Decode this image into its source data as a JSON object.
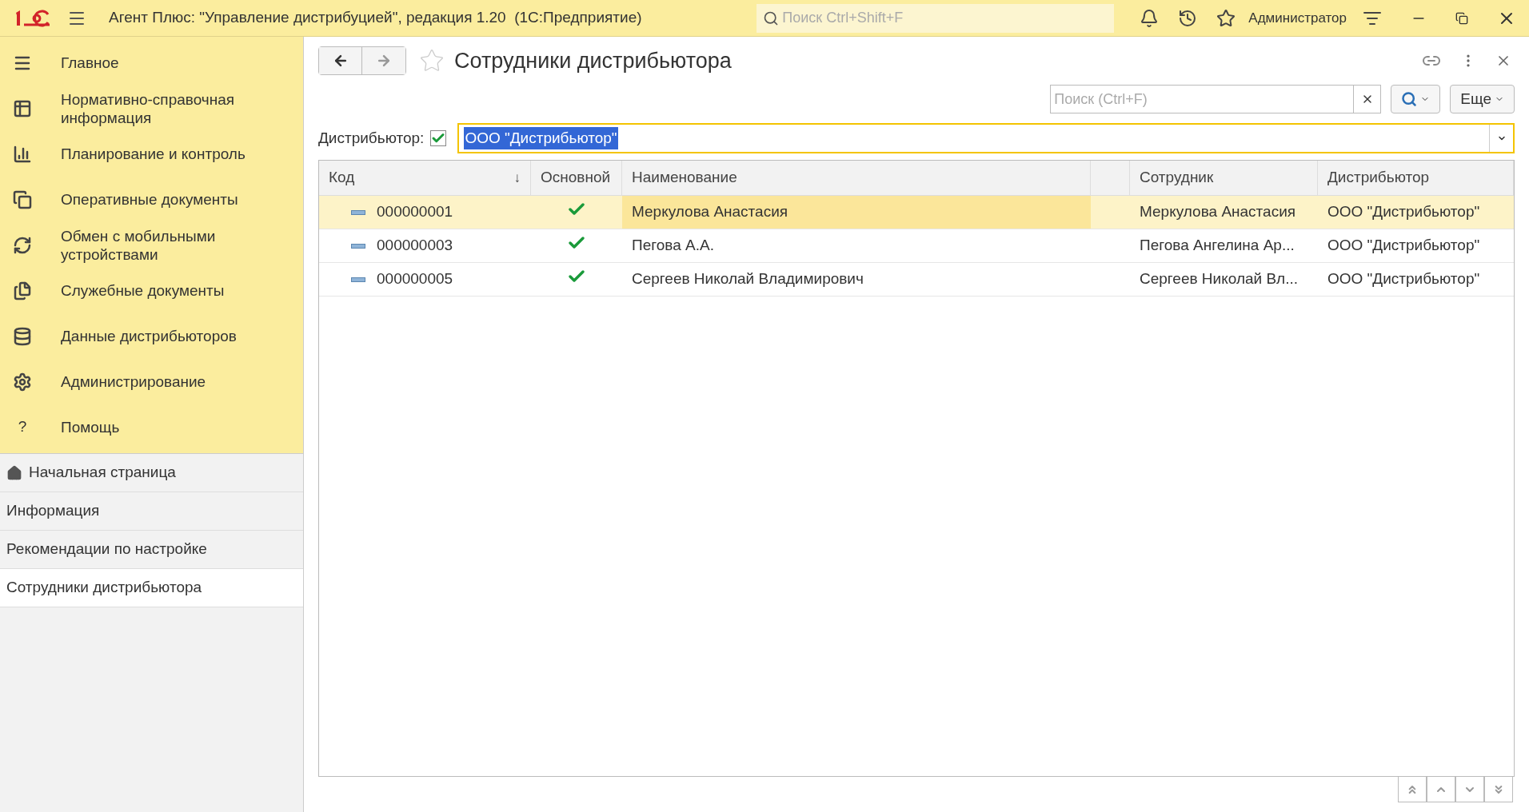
{
  "app_bar": {
    "title": "Агент Плюс: \"Управление дистрибуцией\", редакция 1.20  (1С:Предприятие)",
    "search": {
      "placeholder": "Поиск Ctrl+Shift+F"
    },
    "user": "Администратор"
  },
  "sections": [
    {
      "label": "Главное"
    },
    {
      "label": "Нормативно-справочная информация"
    },
    {
      "label": "Планирование и контроль"
    },
    {
      "label": "Оперативные документы"
    },
    {
      "label": "Обмен с мобильными устройствами"
    },
    {
      "label": "Служебные документы"
    },
    {
      "label": "Данные дистрибьюторов"
    },
    {
      "label": "Администрирование"
    },
    {
      "label": "Помощь",
      "glyph": "?"
    }
  ],
  "open_pages": [
    {
      "label": "Начальная страница",
      "home": true,
      "selected": false
    },
    {
      "label": "Информация",
      "home": false,
      "selected": false
    },
    {
      "label": "Рекомендации по настройке",
      "home": false,
      "selected": false
    },
    {
      "label": "Сотрудники дистрибьютора",
      "home": false,
      "selected": true
    }
  ],
  "form": {
    "title": "Сотрудники дистрибьютора",
    "search": {
      "placeholder": "Поиск (Ctrl+F)"
    },
    "more_button": "Еще",
    "filter": {
      "label": "Дистрибьютор:",
      "checked": true,
      "value": "ООО \"Дистрибьютор\""
    }
  },
  "table": {
    "columns": [
      "Код",
      "Основной",
      "Наименование",
      "Сотрудник",
      "Дистрибьютор"
    ],
    "sort_arrow": "↓",
    "rows": [
      {
        "code": "000000001",
        "main": true,
        "name": "Меркулова Анастасия",
        "employee": "Меркулова Анастасия",
        "distributor": "ООО \"Дистрибьютор\"",
        "selected": true
      },
      {
        "code": "000000003",
        "main": true,
        "name": "Пегова А.А.",
        "employee": "Пегова Ангелина Ар...",
        "distributor": "ООО \"Дистрибьютор\"",
        "selected": false
      },
      {
        "code": "000000005",
        "main": true,
        "name": "Сергеев Николай Владимирович",
        "employee": "Сергеев Николай Вл...",
        "distributor": "ООО \"Дистрибьютор\"",
        "selected": false
      }
    ]
  }
}
